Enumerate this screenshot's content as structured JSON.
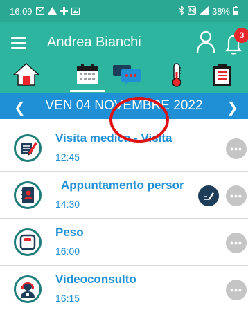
{
  "status_bar": {
    "time": "16:09",
    "battery": "38%",
    "left_icons": [
      "mail-icon",
      "warning-icon",
      "medical-cross-icon",
      "gallery-icon"
    ],
    "right_icons": [
      "bluetooth-icon",
      "nfc-icon",
      "signal-icon",
      "battery-icon"
    ]
  },
  "header": {
    "user_name": "Andrea Bianchi",
    "notification_count": "3",
    "bg_color": "#2db5a0"
  },
  "tabs": [
    {
      "id": "home",
      "icon": "home-icon",
      "active": false
    },
    {
      "id": "calendar",
      "icon": "calendar-icon",
      "active": true
    },
    {
      "id": "chat",
      "icon": "chat-icon",
      "active": false
    },
    {
      "id": "thermometer",
      "icon": "thermometer-icon",
      "active": false
    },
    {
      "id": "clipboard",
      "icon": "clipboard-icon",
      "active": false
    }
  ],
  "date_bar": {
    "label": "VEN 04 NOVEMBRE 2022",
    "prev_symbol": "❮",
    "next_symbol": "❯",
    "color": "#1f8fd6"
  },
  "events": [
    {
      "title": "Visita medica - Visita",
      "time": "12:45",
      "icon": "medical-note-icon",
      "has_edit": false
    },
    {
      "title": "Appuntamento persor",
      "time": "14:30",
      "icon": "address-book-icon",
      "has_edit": true
    },
    {
      "title": "Peso",
      "time": "16:00",
      "icon": "scale-icon",
      "has_edit": false
    },
    {
      "title": "Videoconsulto",
      "time": "16:15",
      "icon": "doctor-headset-icon",
      "has_edit": false
    }
  ],
  "more_label": "•••"
}
